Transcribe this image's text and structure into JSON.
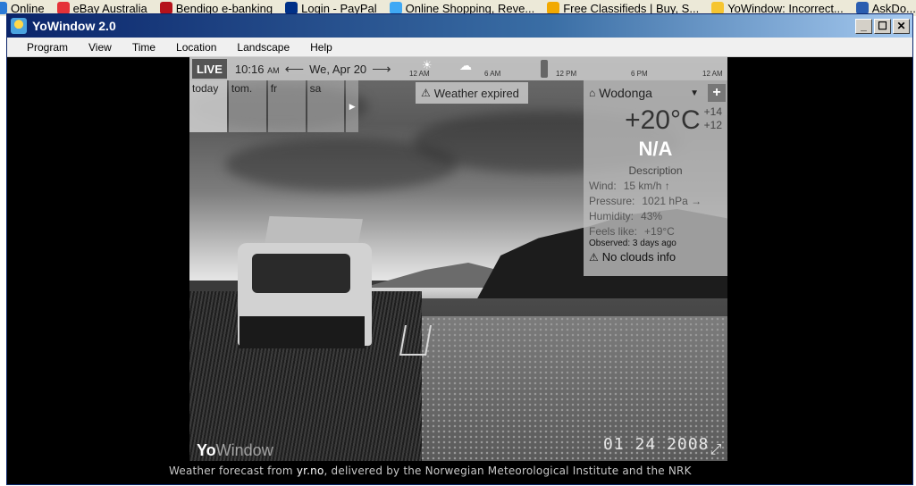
{
  "bookmarks": [
    {
      "label": "Online",
      "color": "#2b7bd6"
    },
    {
      "label": "eBay Australia",
      "color": "#e53238"
    },
    {
      "label": "Bendigo e-banking",
      "color": "#b5121b"
    },
    {
      "label": "Login - PayPal",
      "color": "#003087"
    },
    {
      "label": "Online Shopping, Reve...",
      "color": "#3fa9f5"
    },
    {
      "label": "Free Classifieds | Buy, S...",
      "color": "#f2a900"
    },
    {
      "label": "YoWindow: Incorrect...",
      "color": "#f6c530"
    },
    {
      "label": "AskDo...",
      "color": "#2a5db0"
    }
  ],
  "window": {
    "title": "YoWindow 2.0",
    "minimize": "_",
    "maximize": "☐",
    "close": "✕"
  },
  "menu": [
    "Program",
    "View",
    "Time",
    "Location",
    "Landscape",
    "Help"
  ],
  "timebar": {
    "live": "LIVE",
    "time": "10:16",
    "ampm": "AM",
    "date": "We, Apr 20",
    "ticks": [
      "12 AM",
      "6 AM",
      "12 PM",
      "6 PM",
      "12 AM"
    ]
  },
  "days": [
    "today",
    "tom.",
    "fr",
    "sa"
  ],
  "alert": "Weather expired",
  "weather": {
    "location": "Wodonga",
    "temperature": "+20°C",
    "high": "+14",
    "low": "+12",
    "condition": "N/A",
    "description": "Description",
    "wind_label": "Wind:",
    "wind_value": "15 km/h",
    "pressure_label": "Pressure:",
    "pressure_value": "1021 hPa →",
    "humidity_label": "Humidity:",
    "humidity_value": "43%",
    "feels_label": "Feels like:",
    "feels_value": "+19°C",
    "observed_label": "Observed:",
    "observed_value": "3 days ago",
    "clouds": "No clouds info"
  },
  "scene": {
    "logo_bold": "Yo",
    "logo_light": "Window",
    "date_stamp": "01 24 2008"
  },
  "credit": {
    "prefix": "Weather forecast from",
    "link": "yr.no",
    "suffix": ", delivered by the Norwegian Meteorological Institute and the NRK"
  }
}
